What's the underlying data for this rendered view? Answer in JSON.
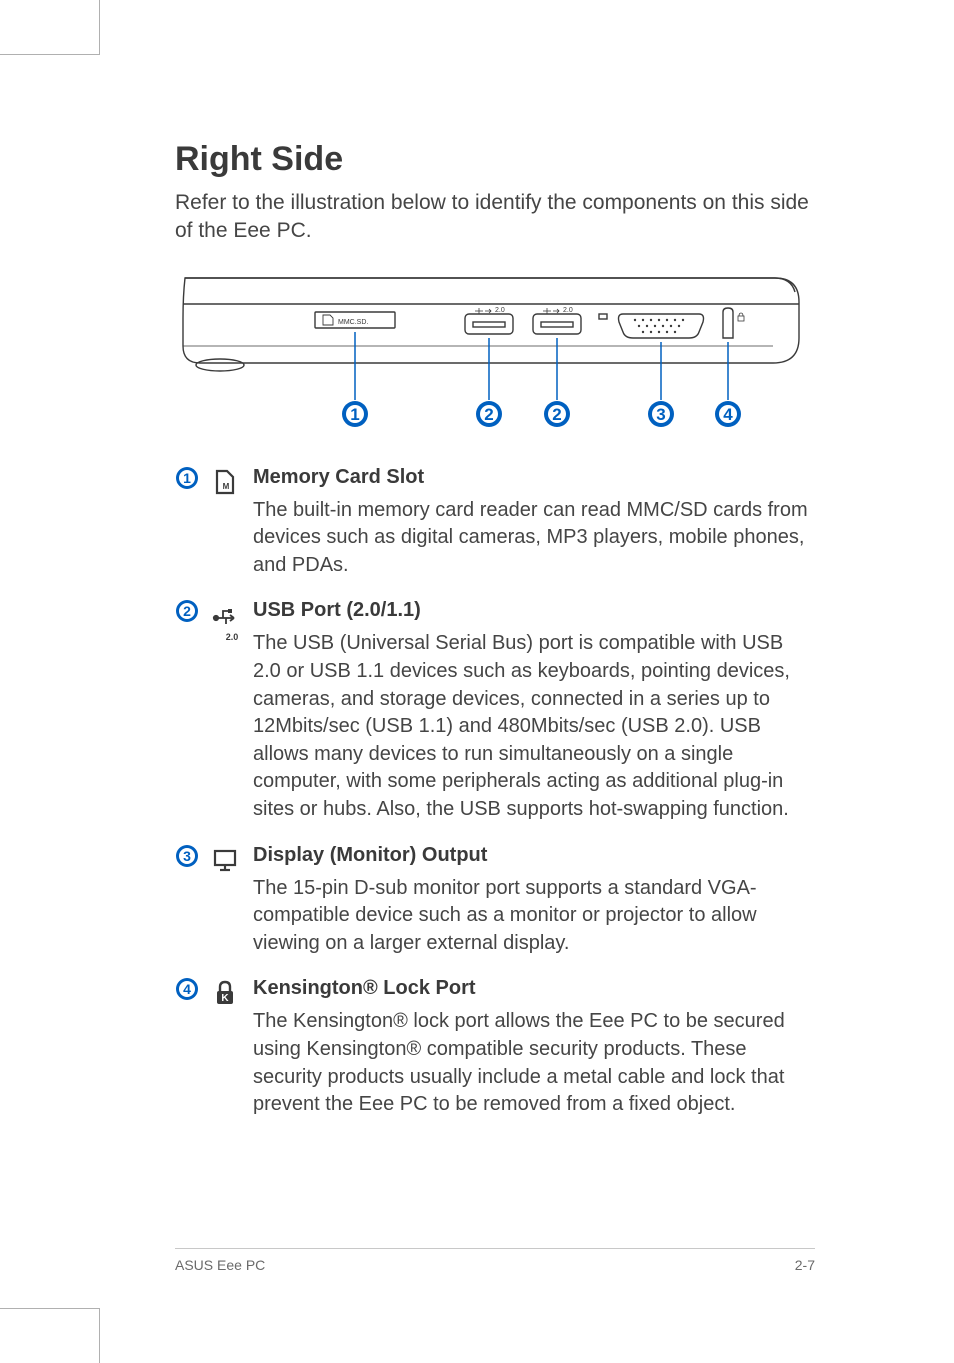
{
  "section": {
    "title": "Right Side",
    "intro": "Refer to the illustration below to identify the components on this side of the Eee PC."
  },
  "diagram": {
    "callouts": [
      "1",
      "2",
      "2",
      "3",
      "4"
    ],
    "port_labels": {
      "mmc": "MMC.SD.",
      "usb": "2.0"
    }
  },
  "items": [
    {
      "num": "1",
      "icon": "memory-card-icon",
      "title": "Memory Card Slot",
      "body": "The built-in memory card reader can read MMC/SD cards from devices such as digital cameras, MP3 players, mobile phones, and PDAs."
    },
    {
      "num": "2",
      "icon": "usb-icon",
      "icon_sub": "2.0",
      "title": "USB Port (2.0/1.1)",
      "body": "The USB (Universal Serial Bus) port is compatible with USB 2.0 or USB 1.1 devices such as keyboards, pointing devices, cameras, and storage devices, connected in a series up to 12Mbits/sec (USB 1.1) and 480Mbits/sec (USB 2.0). USB allows many devices to run simultaneously on a single computer, with some peripherals acting as additional plug-in sites or hubs. Also, the USB supports hot-swapping function."
    },
    {
      "num": "3",
      "icon": "monitor-icon",
      "title": "Display (Monitor) Output",
      "body": "The 15-pin D-sub monitor port supports a standard VGA-compatible device such as a monitor or projector to allow viewing on a larger external display."
    },
    {
      "num": "4",
      "icon": "lock-icon",
      "title": "Kensington® Lock Port",
      "body": "The Kensington® lock port allows the Eee PC to be secured using Kensington® compatible security products. These security products usually include a metal cable and lock that prevent the Eee PC to be removed from a fixed object."
    }
  ],
  "footer": {
    "left": "ASUS Eee PC",
    "right": "2-7"
  }
}
